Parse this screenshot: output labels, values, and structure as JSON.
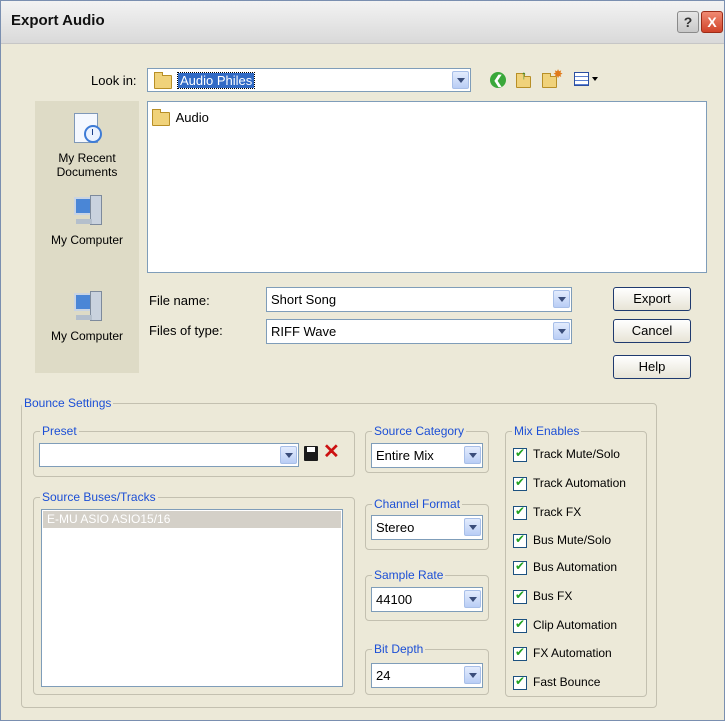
{
  "window": {
    "title": "Export Audio",
    "help_label": "?",
    "close_label": "X"
  },
  "look_in": {
    "label": "Look in:",
    "value": "Audio Philes"
  },
  "places": [
    {
      "label_line1": "My Recent",
      "label_line2": "Documents",
      "icon": "recent-documents-icon"
    },
    {
      "label_line1": "My Computer",
      "icon": "my-computer-icon"
    },
    {
      "label_line1": "My Computer",
      "icon": "my-computer-icon"
    }
  ],
  "file_list": [
    {
      "name": "Audio",
      "type": "folder"
    }
  ],
  "file_name": {
    "label": "File name:",
    "value": "Short Song"
  },
  "file_type": {
    "label": "Files of type:",
    "value": "RIFF Wave"
  },
  "buttons": {
    "export": "Export",
    "cancel": "Cancel",
    "help": "Help"
  },
  "bounce": {
    "title": "Bounce Settings",
    "preset_label": "Preset",
    "preset_value": "",
    "source_label": "Source Buses/Tracks",
    "source_item": "E-MU ASIO ASIO15/16",
    "source_category": {
      "label": "Source Category",
      "value": "Entire Mix"
    },
    "channel_format": {
      "label": "Channel Format",
      "value": "Stereo"
    },
    "sample_rate": {
      "label": "Sample Rate",
      "value": "44100"
    },
    "bit_depth": {
      "label": "Bit Depth",
      "value": "24"
    },
    "mix_enables": {
      "label": "Mix Enables",
      "items": [
        "Track Mute/Solo",
        "Track Automation",
        "Track FX",
        "Bus Mute/Solo",
        "Bus Automation",
        "Bus FX",
        "Clip Automation",
        "FX Automation",
        "Fast Bounce"
      ],
      "checked": [
        true,
        true,
        true,
        true,
        true,
        true,
        true,
        true,
        true
      ]
    }
  }
}
